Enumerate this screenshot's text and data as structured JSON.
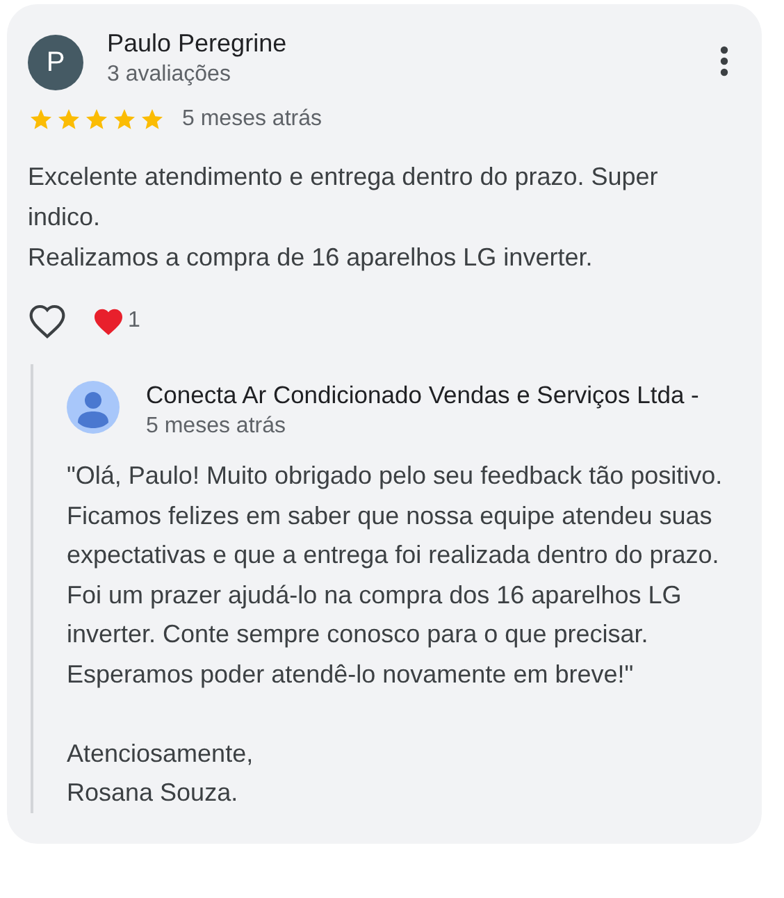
{
  "review": {
    "avatar_letter": "P",
    "author": "Paulo Peregrine",
    "review_count": "3 avaliações",
    "stars": 5,
    "time": "5 meses atrás",
    "text": "Excelente atendimento e entrega dentro do prazo. Super indico.\nRealizamos a compra de 16 aparelhos LG inverter.",
    "liked": false,
    "reaction_count": "1"
  },
  "reply": {
    "author": "Conecta Ar Condicionado Vendas e Serviços Ltda -",
    "time": "5 meses atrás",
    "text": "\"Olá, Paulo! Muito obrigado pelo seu feedback tão positivo. Ficamos felizes em saber que nossa equipe atendeu suas expectativas e que a entrega foi realizada dentro do prazo. Foi um prazer ajudá-lo na compra dos 16 aparelhos LG inverter. Conte sempre conosco para o que precisar. Esperamos poder atendê-lo novamente em breve!\"",
    "signoff": "Atenciosamente,\nRosana Souza."
  }
}
